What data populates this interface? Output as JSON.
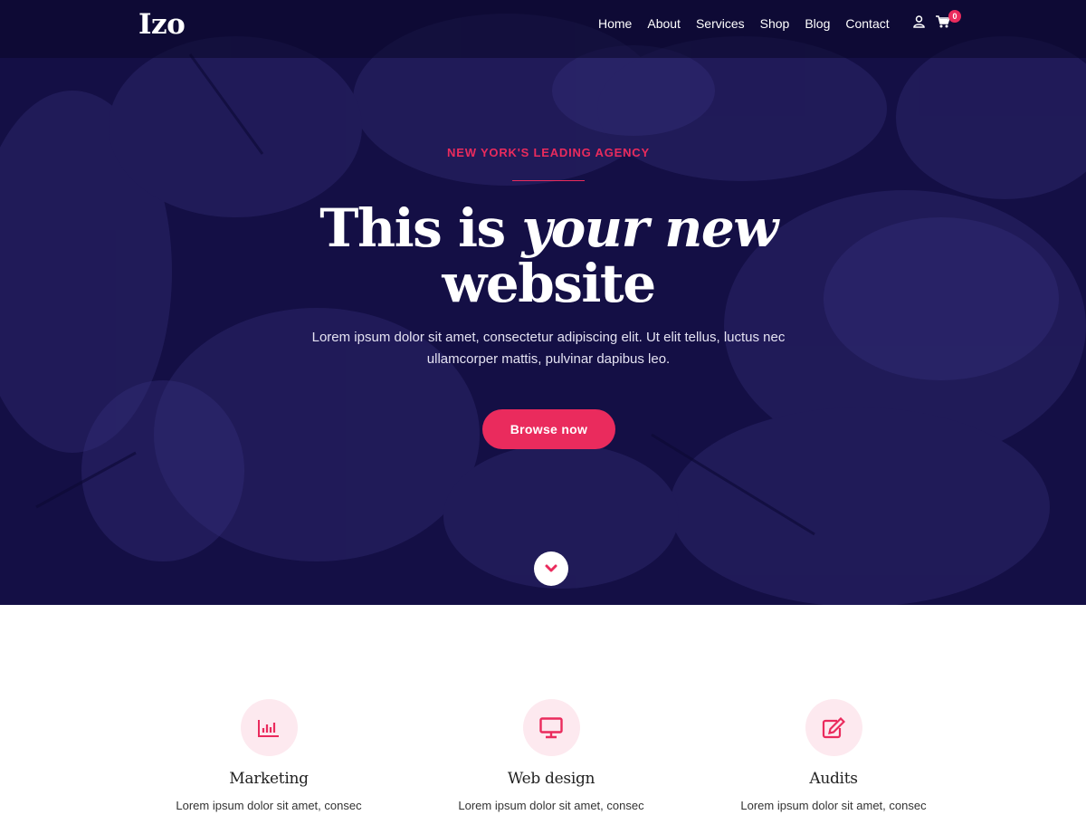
{
  "header": {
    "logo": "Izo",
    "nav": [
      "Home",
      "About",
      "Services",
      "Shop",
      "Blog",
      "Contact"
    ],
    "user_icon": "user-icon",
    "cart_icon": "cart-icon",
    "cart_count": "0"
  },
  "hero": {
    "eyebrow": "NEW YORK'S LEADING AGENCY",
    "title_plain": "This is",
    "title_italic": "your new",
    "title_line2": "website",
    "text": "Lorem ipsum dolor sit amet, consectetur adipiscing elit. Ut elit tellus, luctus nec ullamcorper mattis, pulvinar dapibus leo.",
    "cta": "Browse now",
    "scroll_icon": "chevron-down-icon"
  },
  "features": [
    {
      "icon": "bar-chart-icon",
      "title": "Marketing",
      "text": "Lorem ipsum dolor sit amet, consec"
    },
    {
      "icon": "monitor-icon",
      "title": "Web design",
      "text": "Lorem ipsum dolor sit amet, consec"
    },
    {
      "icon": "edit-icon",
      "title": "Audits",
      "text": "Lorem ipsum dolor sit amet, consec"
    }
  ],
  "colors": {
    "hero_bg": "#140f45",
    "accent": "#ea2b5d",
    "icon_circle": "#fde9ef"
  }
}
